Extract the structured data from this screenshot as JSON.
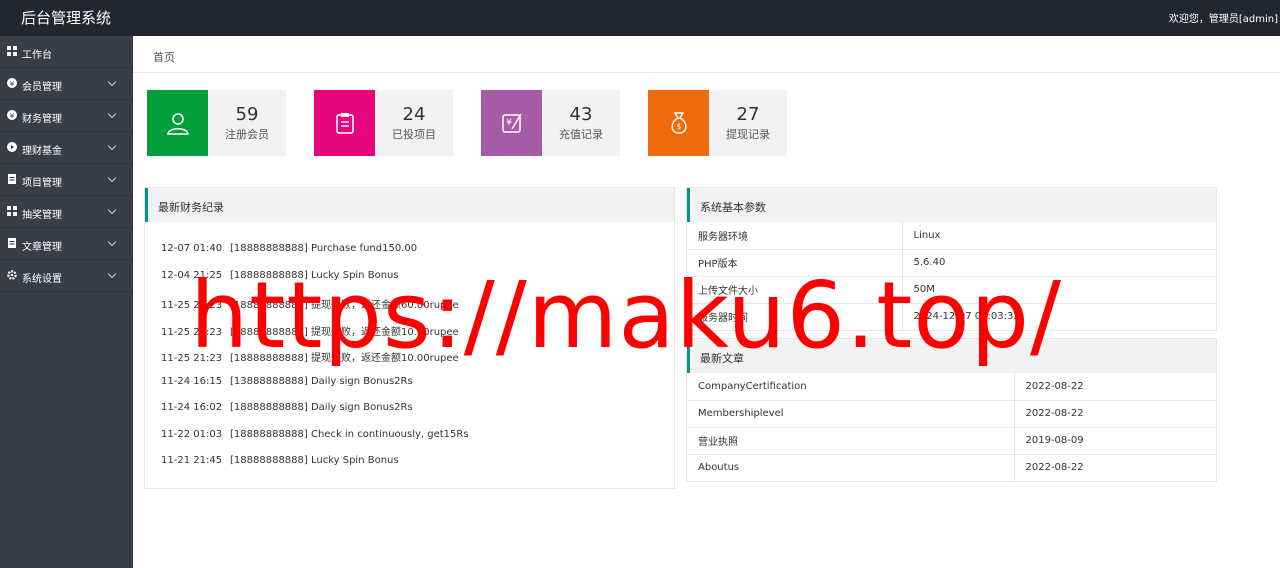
{
  "header": {
    "title": "后台管理系统",
    "welcome": "欢迎您，管理员[admin]"
  },
  "sidebar": {
    "items": [
      {
        "label": "工作台",
        "icon": "dashboard-icon"
      },
      {
        "label": "会员管理",
        "icon": "user-icon"
      },
      {
        "label": "财务管理",
        "icon": "finance-icon"
      },
      {
        "label": "理财基金",
        "icon": "fund-icon"
      },
      {
        "label": "项目管理",
        "icon": "project-icon"
      },
      {
        "label": "抽奖管理",
        "icon": "lottery-icon"
      },
      {
        "label": "文章管理",
        "icon": "article-icon"
      },
      {
        "label": "系统设置",
        "icon": "gear-icon"
      }
    ]
  },
  "breadcrumb": "首页",
  "stats": [
    {
      "value": "59",
      "label": "注册会员",
      "color": "#009f3c",
      "icon": "user-icon"
    },
    {
      "value": "24",
      "label": "已投项目",
      "color": "#e7067e",
      "icon": "clipboard-icon"
    },
    {
      "value": "43",
      "label": "充值记录",
      "color": "#a55ba6",
      "icon": "recharge-icon"
    },
    {
      "value": "27",
      "label": "提现记录",
      "color": "#ee6a0a",
      "icon": "money-bag-icon"
    }
  ],
  "finance": {
    "title": "最新财务纪录",
    "records": [
      {
        "time": "12-07 01:40",
        "text": "[18888888888] Purchase fund150.00"
      },
      {
        "time": "12-04 21:25",
        "text": "[18888888888] Lucky Spin Bonus"
      },
      {
        "time": "11-25 21:23",
        "text": "[18888888888] 提现失败，返还金额60.00rupee"
      },
      {
        "time": "11-25 21:23",
        "text": "[18888888888] 提现失败，返还金额10.00rupee"
      },
      {
        "time": "11-25 21:23",
        "text": "[18888888888] 提现失败，返还金额10.00rupee"
      },
      {
        "time": "11-24 16:15",
        "text": "[13888888888] Daily sign Bonus2Rs"
      },
      {
        "time": "11-24 16:02",
        "text": "[18888888888] Daily sign Bonus2Rs"
      },
      {
        "time": "11-22 01:03",
        "text": "[18888888888] Check in continuously, get15Rs"
      },
      {
        "time": "11-21 21:45",
        "text": "[18888888888] Lucky Spin Bonus"
      }
    ]
  },
  "system": {
    "title": "系统基本参数",
    "rows": [
      {
        "key": "服务器环境",
        "value": "Linux"
      },
      {
        "key": "PHP版本",
        "value": "5.6.40"
      },
      {
        "key": "上传文件大小",
        "value": "50M"
      },
      {
        "key": "服务器时间",
        "value": "2024-12-07 01:03:32"
      }
    ]
  },
  "articles": {
    "title": "最新文章",
    "rows": [
      {
        "name": "CompanyCertification",
        "date": "2022-08-22"
      },
      {
        "name": "Membershiplevel",
        "date": "2022-08-22"
      },
      {
        "name": "营业执照",
        "date": "2019-08-09"
      },
      {
        "name": "Aboutus",
        "date": "2022-08-22"
      }
    ]
  },
  "watermark": "https://maku6.top/"
}
